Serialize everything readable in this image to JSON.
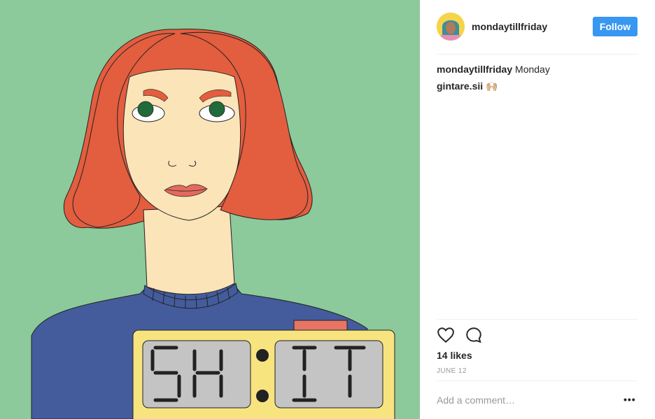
{
  "post": {
    "username": "mondaytillfriday",
    "follow_label": "Follow",
    "caption_user": "mondaytillfriday",
    "caption_text": "Monday",
    "comment_user": "gintare.sii",
    "comment_text": "🙌🏼",
    "likes": "14 likes",
    "date": "JUNE 12",
    "comment_placeholder": "Add a comment…",
    "more_label": "•••"
  },
  "illustration": {
    "clock_left": "SH",
    "clock_right": "IT",
    "colors": {
      "background": "#8cc99b",
      "hair": "#e35d3f",
      "skin": "#fbe4b8",
      "sweater": "#445c9c",
      "clock_body": "#f7e47f",
      "display": "#c4c4c4"
    }
  },
  "colors": {
    "follow_button": "#3897f0"
  }
}
